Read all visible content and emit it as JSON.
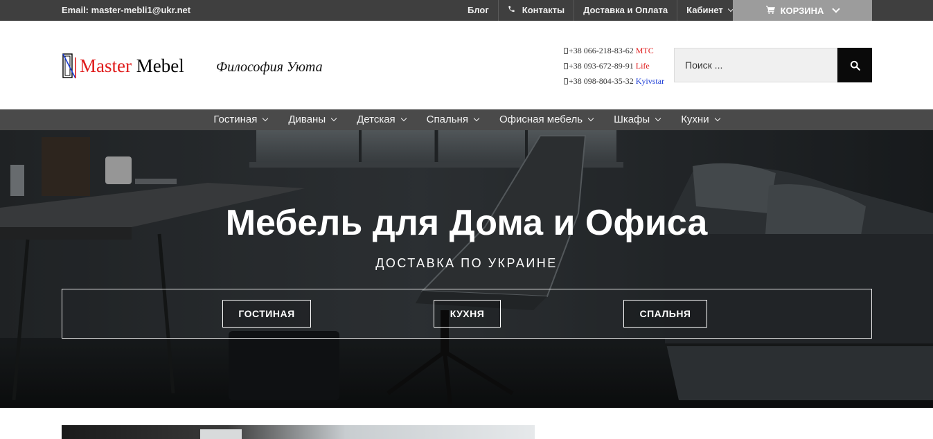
{
  "topbar": {
    "email": "Email: master-mebli1@ukr.net",
    "links": [
      {
        "label": "Блог"
      },
      {
        "label": "Контакты",
        "icon": "phone-icon"
      },
      {
        "label": "Доставка и Оплата"
      },
      {
        "label": "Кабинет",
        "icon": "chevron-down-icon"
      }
    ],
    "cart_label": "КОРЗИНА"
  },
  "header": {
    "logo_word1": "Master",
    "logo_word2": "Mebel",
    "slogan": "Философия Уюта",
    "phones": [
      {
        "number": "+38 066-218-83-62",
        "operator": "МТС"
      },
      {
        "number": "+38 093-672-89-91",
        "operator": "Life"
      },
      {
        "number": "+38 098-804-35-32",
        "operator": "Kyivstar"
      }
    ],
    "search_placeholder": "Поиск ..."
  },
  "nav": {
    "items": [
      {
        "label": "Гостиная"
      },
      {
        "label": "Диваны"
      },
      {
        "label": "Детская"
      },
      {
        "label": "Спальня"
      },
      {
        "label": "Офисная мебель"
      },
      {
        "label": "Шкафы"
      },
      {
        "label": "Кухни"
      }
    ]
  },
  "hero": {
    "title": "Мебель для Дома и Офиса",
    "subtitle": "ДОСТАВКА ПО УКРАИНЕ",
    "buttons": [
      {
        "label": "ГОСТИНАЯ"
      },
      {
        "label": "КУХНЯ"
      },
      {
        "label": "СПАЛЬНЯ"
      }
    ]
  },
  "colors": {
    "topbar_bg": "#3f3f3f",
    "cart_bg": "#9c9c9c",
    "nav_bg": "#4a4a4a",
    "logo_red": "#e01b1b",
    "kyivstar_blue": "#1a3bd6",
    "search_button": "#0a0a0a"
  }
}
